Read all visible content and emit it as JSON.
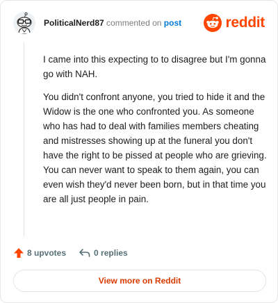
{
  "header": {
    "username": "PoliticalNerd87",
    "action_text": "commented on",
    "post_link": "post",
    "brand": "reddit",
    "avatar_icon": "snoo-avatar-icon",
    "brand_icon": "reddit-logo-icon",
    "brand_color": "#ff4500"
  },
  "comment": {
    "paragraphs": [
      "I came into this expecting to to disagree but I'm gonna go with NAH.",
      "You didn't confront anyone, you tried to hide it and the Widow is the one who confronted you. As someone who has had to deal with families members cheating and mistresses showing up at the funeral you don't have the right to be pissed at people who are grieving. You can never want to speak to them again, you can even wish they'd never been born, but in that time you are all just people in pain."
    ]
  },
  "actions": {
    "upvotes_label": "8 upvotes",
    "replies_label": "0 replies",
    "upvote_icon": "upvote-arrow-icon",
    "reply_icon": "reply-arrow-icon",
    "upvote_color": "#ff4500"
  },
  "footer": {
    "view_more_label": "View more on Reddit",
    "view_more_color": "#d93a00"
  }
}
